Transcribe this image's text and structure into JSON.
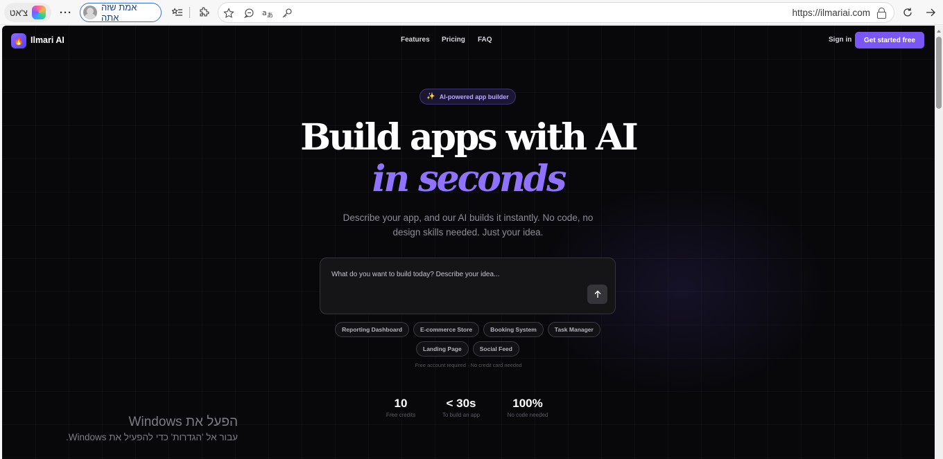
{
  "browser": {
    "copilot_label": "צ'אט",
    "profile_label": "אמת שזה אתה",
    "url": "https://ilmariai.com"
  },
  "site": {
    "brand": "Ilmari AI",
    "nav": [
      "Features",
      "Pricing",
      "FAQ"
    ],
    "sign_in": "Sign in",
    "cta": "Get started free"
  },
  "hero": {
    "badge": "AI-powered app builder",
    "title_line1": "Build apps with AI",
    "title_line2": "in seconds",
    "subtitle": "Describe your app, and our AI builds it instantly. No code, no design skills needed. Just your idea."
  },
  "prompt": {
    "placeholder": "What do you want to build today? Describe your idea..."
  },
  "suggestions": [
    "Reporting Dashboard",
    "E-commerce Store",
    "Booking System",
    "Task Manager",
    "Landing Page",
    "Social Feed"
  ],
  "fine_print": "Free account required · No credit card needed",
  "stats": [
    {
      "value": "10",
      "label": "Free credits"
    },
    {
      "value": "< 30s",
      "label": "To build an app"
    },
    {
      "value": "100%",
      "label": "No code needed"
    }
  ],
  "watermark": {
    "title": "הפעל את Windows",
    "subtitle": "עבור אל 'הגדרות' כדי להפעיל את Windows."
  },
  "colors": {
    "accent": "#7a57f5",
    "accent_text": "#8f73ff",
    "page_bg": "#08080b"
  }
}
